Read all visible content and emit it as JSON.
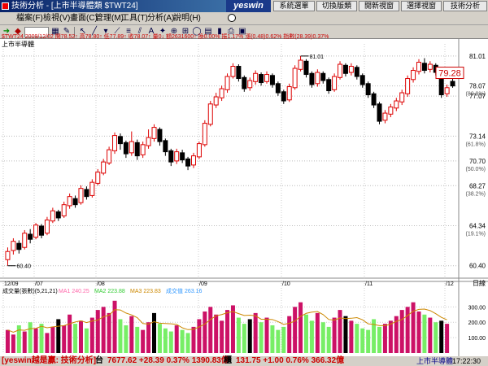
{
  "window": {
    "title": "技術分析 - [上市半導體類 $TWT24]",
    "brand": "yeswin",
    "top_buttons": [
      "系統選單",
      "切換版類",
      "開新視窗",
      "選擇視窗",
      "技術分析"
    ]
  },
  "menu": [
    "檔案(F)",
    "檢視(V)",
    "畫面(C)",
    "管理(M)",
    "工具(T)",
    "分析(A)",
    "說明(H)"
  ],
  "toolbar": {
    "select_value": "",
    "icons": [
      "arrow-icon",
      "back-icon",
      "chart-icon",
      "cursor-icon",
      "pen-icon",
      "line-icon",
      "ruler-icon",
      "diagonal-icon",
      "fib-icon",
      "text-icon",
      "zoom-icon",
      "grid-icon",
      "table-icon",
      "bar-icon",
      "save-icon",
      "print-icon"
    ]
  },
  "info": {
    "name": "上市半導體",
    "line": "$TWT24 2009/12/02 開78.52↑ 高78.80↑ 低77.89↑ 收78.07↑ 量0↓ 額2631600↑ 換0.00% 振1.17% 漲(0.48)0.62% 指數(28.39)0.37%",
    "high_label": "81.01",
    "low_label": "60.40",
    "current_price": "79.28"
  },
  "price_axis": [
    {
      "value": 81.01,
      "label": "81.01",
      "sub": ""
    },
    {
      "value": 78.07,
      "label": "78.07",
      "sub": "(80.9%)"
    },
    {
      "value": 77.07,
      "label": "77.07",
      "sub": ""
    },
    {
      "value": 73.14,
      "label": "73.14",
      "sub": "(61.8%)"
    },
    {
      "value": 70.7,
      "label": "70.70",
      "sub": "(50.0%)"
    },
    {
      "value": 68.27,
      "label": "68.27",
      "sub": "(38.2%)"
    },
    {
      "value": 64.34,
      "label": "64.34",
      "sub": "(19.1%)"
    },
    {
      "value": 60.4,
      "label": "60.40",
      "sub": ""
    }
  ],
  "date_axis": [
    "12/09",
    "/07",
    "/08",
    "/09",
    "/10",
    "/11",
    "/12"
  ],
  "date_axis_unit": "日線",
  "volume_header": "成交量(張數)(5,21,21)",
  "volume_legend": [
    {
      "label": "MA1 240.25",
      "color": "#ff66aa"
    },
    {
      "label": "MA2 223.88",
      "color": "#33cc33"
    },
    {
      "label": "MA3 223.83",
      "color": "#cc8800"
    },
    {
      "label": "成交值 263.16",
      "color": "#3399ff"
    }
  ],
  "volume_axis": [
    {
      "value": 300,
      "label": "300.00"
    },
    {
      "value": 200,
      "label": "200.00"
    },
    {
      "value": 100,
      "label": "100.00"
    }
  ],
  "chart_data": {
    "type": "candlestick",
    "ylim": [
      59.5,
      82.2
    ],
    "candles": [
      {
        "o": 61.0,
        "c": 61.8,
        "h": 62.2,
        "l": 60.4
      },
      {
        "o": 61.9,
        "c": 62.8,
        "h": 63.1,
        "l": 61.5
      },
      {
        "o": 62.6,
        "c": 62.0,
        "h": 62.9,
        "l": 61.6
      },
      {
        "o": 62.2,
        "c": 63.6,
        "h": 63.9,
        "l": 62.0
      },
      {
        "o": 63.5,
        "c": 63.0,
        "h": 64.0,
        "l": 62.6
      },
      {
        "o": 63.2,
        "c": 64.4,
        "h": 64.6,
        "l": 63.0
      },
      {
        "o": 64.3,
        "c": 63.4,
        "h": 64.5,
        "l": 63.1
      },
      {
        "o": 63.6,
        "c": 64.9,
        "h": 65.2,
        "l": 63.4
      },
      {
        "o": 64.8,
        "c": 65.8,
        "h": 66.1,
        "l": 64.6
      },
      {
        "o": 65.7,
        "c": 65.1,
        "h": 65.9,
        "l": 64.8
      },
      {
        "o": 65.3,
        "c": 66.4,
        "h": 66.7,
        "l": 65.1
      },
      {
        "o": 66.3,
        "c": 67.2,
        "h": 67.5,
        "l": 66.0
      },
      {
        "o": 67.0,
        "c": 66.4,
        "h": 67.3,
        "l": 66.1
      },
      {
        "o": 66.6,
        "c": 68.0,
        "h": 68.3,
        "l": 66.4
      },
      {
        "o": 67.9,
        "c": 67.2,
        "h": 68.2,
        "l": 66.9
      },
      {
        "o": 67.3,
        "c": 68.6,
        "h": 68.9,
        "l": 67.1
      },
      {
        "o": 68.5,
        "c": 69.6,
        "h": 69.9,
        "l": 68.3
      },
      {
        "o": 69.5,
        "c": 70.6,
        "h": 70.9,
        "l": 69.3
      },
      {
        "o": 70.5,
        "c": 71.8,
        "h": 72.1,
        "l": 70.3
      },
      {
        "o": 71.7,
        "c": 73.2,
        "h": 73.5,
        "l": 71.4
      },
      {
        "o": 73.1,
        "c": 72.4,
        "h": 73.4,
        "l": 71.8
      },
      {
        "o": 72.5,
        "c": 71.4,
        "h": 72.7,
        "l": 71.0
      },
      {
        "o": 71.5,
        "c": 72.6,
        "h": 73.6,
        "l": 71.2
      },
      {
        "o": 72.5,
        "c": 71.2,
        "h": 72.8,
        "l": 70.8
      },
      {
        "o": 71.3,
        "c": 72.3,
        "h": 72.6,
        "l": 71.0
      },
      {
        "o": 72.2,
        "c": 73.0,
        "h": 73.8,
        "l": 71.9
      },
      {
        "o": 72.9,
        "c": 74.0,
        "h": 74.3,
        "l": 72.6
      },
      {
        "o": 73.8,
        "c": 72.6,
        "h": 74.0,
        "l": 72.2
      },
      {
        "o": 72.7,
        "c": 71.6,
        "h": 72.9,
        "l": 71.2
      },
      {
        "o": 71.7,
        "c": 70.6,
        "h": 71.9,
        "l": 70.2
      },
      {
        "o": 70.7,
        "c": 71.6,
        "h": 71.9,
        "l": 70.4
      },
      {
        "o": 71.5,
        "c": 70.8,
        "h": 71.8,
        "l": 70.5
      },
      {
        "o": 70.9,
        "c": 70.2,
        "h": 71.1,
        "l": 69.8
      },
      {
        "o": 70.3,
        "c": 71.2,
        "h": 71.5,
        "l": 70.0
      },
      {
        "o": 71.1,
        "c": 72.4,
        "h": 72.6,
        "l": 70.9
      },
      {
        "o": 72.3,
        "c": 74.4,
        "h": 74.7,
        "l": 72.1
      },
      {
        "o": 74.3,
        "c": 76.3,
        "h": 76.6,
        "l": 74.1
      },
      {
        "o": 76.2,
        "c": 77.0,
        "h": 77.4,
        "l": 75.9
      },
      {
        "o": 76.9,
        "c": 77.8,
        "h": 78.1,
        "l": 76.6
      },
      {
        "o": 77.7,
        "c": 79.0,
        "h": 79.3,
        "l": 77.4
      },
      {
        "o": 79.0,
        "c": 80.0,
        "h": 80.3,
        "l": 78.8
      },
      {
        "o": 80.0,
        "c": 78.8,
        "h": 80.2,
        "l": 78.5
      },
      {
        "o": 78.9,
        "c": 77.8,
        "h": 79.1,
        "l": 77.5
      },
      {
        "o": 77.9,
        "c": 78.6,
        "h": 78.9,
        "l": 77.6
      },
      {
        "o": 78.5,
        "c": 79.3,
        "h": 79.6,
        "l": 78.2
      },
      {
        "o": 79.2,
        "c": 78.4,
        "h": 79.4,
        "l": 78.1
      },
      {
        "o": 78.5,
        "c": 79.2,
        "h": 79.5,
        "l": 78.3
      },
      {
        "o": 79.1,
        "c": 78.2,
        "h": 79.3,
        "l": 77.9
      },
      {
        "o": 78.3,
        "c": 77.4,
        "h": 78.5,
        "l": 77.1
      },
      {
        "o": 77.5,
        "c": 76.6,
        "h": 77.7,
        "l": 76.3
      },
      {
        "o": 76.7,
        "c": 78.0,
        "h": 78.3,
        "l": 76.5
      },
      {
        "o": 77.9,
        "c": 79.8,
        "h": 80.1,
        "l": 77.7
      },
      {
        "o": 79.7,
        "c": 80.6,
        "h": 81.01,
        "l": 79.5
      },
      {
        "o": 80.5,
        "c": 79.2,
        "h": 80.7,
        "l": 78.9
      },
      {
        "o": 79.3,
        "c": 78.2,
        "h": 79.5,
        "l": 77.9
      },
      {
        "o": 78.3,
        "c": 79.4,
        "h": 79.7,
        "l": 78.0
      },
      {
        "o": 79.3,
        "c": 78.6,
        "h": 79.5,
        "l": 78.3
      },
      {
        "o": 78.7,
        "c": 77.6,
        "h": 78.9,
        "l": 77.3
      },
      {
        "o": 77.7,
        "c": 79.0,
        "h": 79.3,
        "l": 77.5
      },
      {
        "o": 78.9,
        "c": 80.2,
        "h": 80.5,
        "l": 78.7
      },
      {
        "o": 80.1,
        "c": 79.3,
        "h": 80.3,
        "l": 79.0
      },
      {
        "o": 79.4,
        "c": 80.0,
        "h": 80.3,
        "l": 79.1
      },
      {
        "o": 79.9,
        "c": 79.0,
        "h": 80.1,
        "l": 78.7
      },
      {
        "o": 79.1,
        "c": 78.2,
        "h": 79.3,
        "l": 77.9
      },
      {
        "o": 78.3,
        "c": 77.2,
        "h": 78.5,
        "l": 76.9
      },
      {
        "o": 77.3,
        "c": 76.2,
        "h": 77.5,
        "l": 75.9
      },
      {
        "o": 76.3,
        "c": 74.6,
        "h": 76.5,
        "l": 74.3
      },
      {
        "o": 74.7,
        "c": 75.4,
        "h": 75.7,
        "l": 74.4
      },
      {
        "o": 75.3,
        "c": 76.0,
        "h": 76.3,
        "l": 75.0
      },
      {
        "o": 75.9,
        "c": 76.6,
        "h": 76.9,
        "l": 75.6
      },
      {
        "o": 76.5,
        "c": 77.4,
        "h": 77.7,
        "l": 76.2
      },
      {
        "o": 77.3,
        "c": 78.8,
        "h": 79.1,
        "l": 77.0
      },
      {
        "o": 78.7,
        "c": 79.6,
        "h": 79.9,
        "l": 78.4
      },
      {
        "o": 79.5,
        "c": 80.4,
        "h": 80.7,
        "l": 79.2
      },
      {
        "o": 80.3,
        "c": 79.6,
        "h": 80.8,
        "l": 79.3
      },
      {
        "o": 79.7,
        "c": 80.2,
        "h": 80.5,
        "l": 79.4
      },
      {
        "o": 80.1,
        "c": 79.4,
        "h": 80.3,
        "l": 79.1
      },
      {
        "o": 79.5,
        "c": 77.2,
        "h": 79.7,
        "l": 76.9
      },
      {
        "o": 77.3,
        "c": 77.9,
        "h": 78.2,
        "l": 77.0
      },
      {
        "o": 78.52,
        "c": 78.07,
        "h": 78.8,
        "l": 77.89
      }
    ],
    "volumes": [
      150,
      120,
      180,
      140,
      200,
      160,
      190,
      130,
      170,
      220,
      180,
      250,
      190,
      210,
      160,
      230,
      280,
      300,
      260,
      340,
      220,
      180,
      240,
      170,
      150,
      200,
      260,
      190,
      160,
      140,
      180,
      150,
      130,
      170,
      220,
      270,
      300,
      250,
      210,
      280,
      310,
      230,
      190,
      220,
      260,
      200,
      230,
      180,
      150,
      170,
      240,
      300,
      330,
      250,
      210,
      260,
      200,
      170,
      230,
      280,
      240,
      210,
      190,
      160,
      150,
      220,
      170,
      190,
      210,
      240,
      280,
      300,
      330,
      270,
      250,
      230,
      200,
      210,
      190
    ],
    "volume_ylim": [
      0,
      360
    ]
  },
  "status": {
    "app": "[yeswin越是贏: 技術分析]",
    "tai_label": "台",
    "tai_value": "7677.62 +28.39 0.37% 1390.83億",
    "otc_label": "櫃",
    "otc_value": "131.75 +1.00 0.76% 366.32億",
    "right_label": "上市半導體",
    "time": "17:22:30"
  }
}
